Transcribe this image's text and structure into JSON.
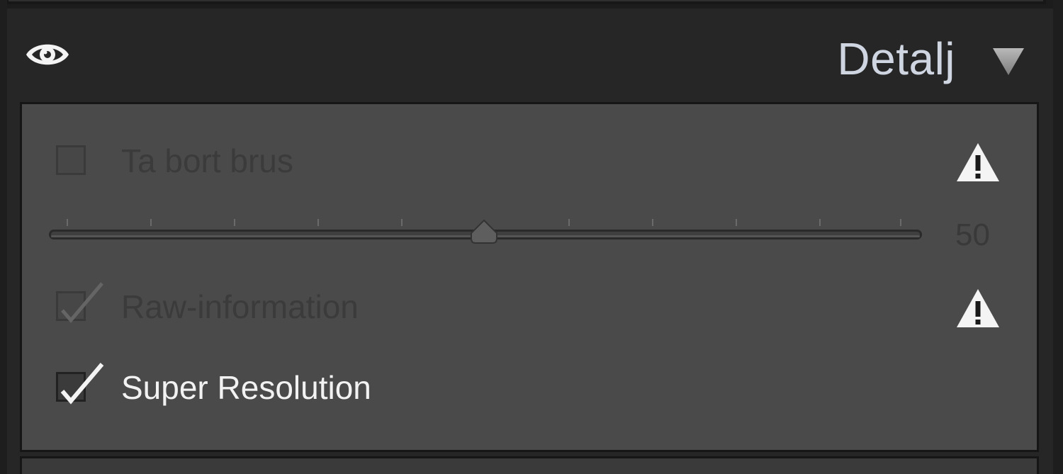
{
  "panel": {
    "title": "Detalj",
    "visibility_icon": "eye-icon",
    "collapse_icon": "triangle-down-icon"
  },
  "options": [
    {
      "label": "Ta bort brus",
      "checked": false,
      "enabled": false,
      "warning": true
    },
    {
      "label": "Raw-information",
      "checked": true,
      "enabled": false,
      "warning": true
    },
    {
      "label": "Super Resolution",
      "checked": true,
      "enabled": true,
      "warning": false
    }
  ],
  "slider": {
    "value": "50",
    "min": 0,
    "max": 100
  },
  "colors": {
    "title": "#cfd6e2",
    "panel_bg": "#4a4a4a",
    "header_bg": "#262626",
    "dim_text": "#3b3b3b",
    "bright_text": "#f2f2f2"
  }
}
